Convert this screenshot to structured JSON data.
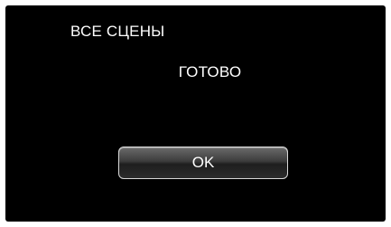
{
  "header": {
    "title": "ВСЕ СЦЕНЫ"
  },
  "dialog": {
    "message": "ГОТОВО",
    "ok_label": "OK"
  },
  "colors": {
    "background": "#000000",
    "text": "#ffffff",
    "button_border": "#d8d8d8"
  }
}
